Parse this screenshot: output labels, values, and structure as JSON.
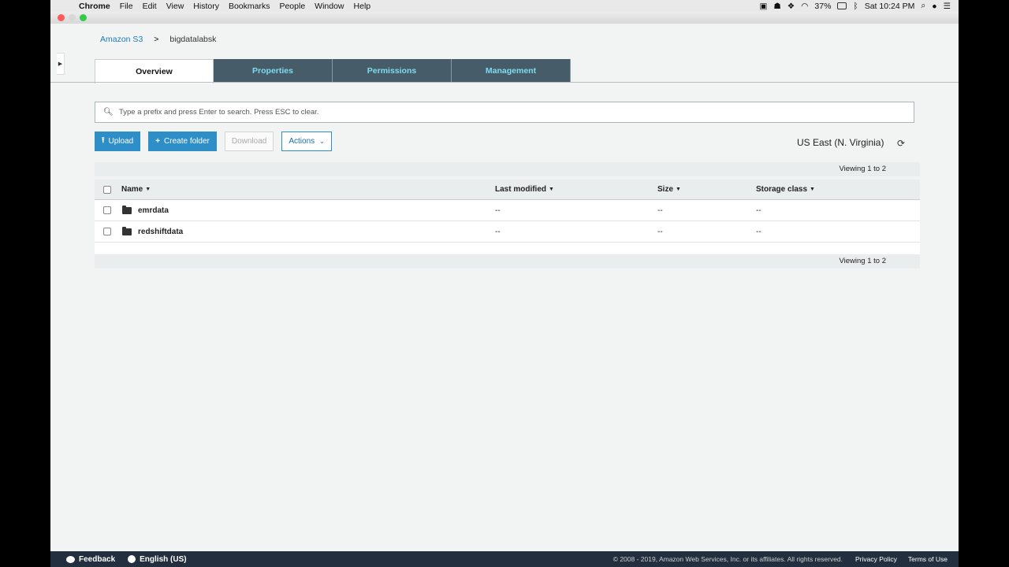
{
  "menubar": {
    "app": "Chrome",
    "items": [
      "File",
      "Edit",
      "View",
      "History",
      "Bookmarks",
      "People",
      "Window",
      "Help"
    ],
    "battery": "37%",
    "clock": "Sat 10:24 PM"
  },
  "breadcrumb": {
    "root": "Amazon S3",
    "separator": ">",
    "current": "bigdatalabsk"
  },
  "tabs": [
    {
      "label": "Overview"
    },
    {
      "label": "Properties"
    },
    {
      "label": "Permissions"
    },
    {
      "label": "Management"
    }
  ],
  "search": {
    "placeholder": "Type a prefix and press Enter to search. Press ESC to clear."
  },
  "toolbar": {
    "upload": "Upload",
    "create_folder": "Create folder",
    "download": "Download",
    "actions": "Actions"
  },
  "region": "US East (N. Virginia)",
  "viewing": "Viewing 1 to 2",
  "table": {
    "headers": {
      "name": "Name",
      "modified": "Last modified",
      "size": "Size",
      "storage": "Storage class"
    },
    "rows": [
      {
        "name": "emrdata",
        "modified": "--",
        "size": "--",
        "storage": "--"
      },
      {
        "name": "redshiftdata",
        "modified": "--",
        "size": "--",
        "storage": "--"
      }
    ]
  },
  "footer": {
    "feedback": "Feedback",
    "language": "English (US)",
    "copyright": "© 2008 - 2019, Amazon Web Services, Inc. or its affiliates. All rights reserved.",
    "privacy": "Privacy Policy",
    "terms": "Terms of Use"
  },
  "colors": {
    "tab_bg": "#465c68",
    "tab_text": "#7fdcf2",
    "primary": "#2d8ec8",
    "footer_bg": "#232f3e"
  }
}
